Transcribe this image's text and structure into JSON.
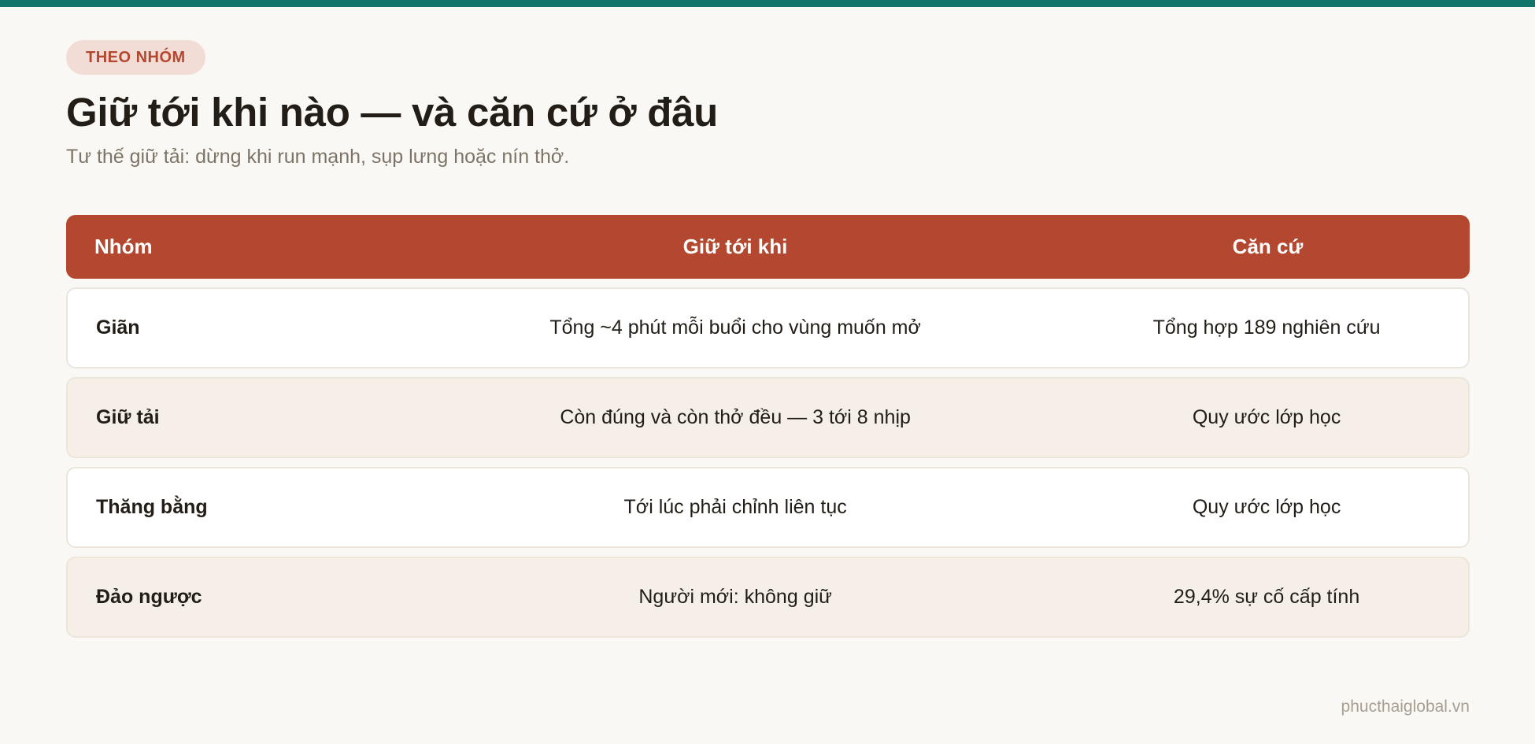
{
  "colors": {
    "top_bar": "#12756b",
    "accent": "#b3472f",
    "pill_bg": "#f2ddd6",
    "background": "#faf8f4",
    "row_odd": "#ffffff",
    "row_even": "#f5efe7"
  },
  "tag": "THEO NHÓM",
  "title": "Giữ tới khi nào — và căn cứ ở đâu",
  "subtitle": "Tư thế giữ tải: dừng khi run mạnh, sụp lưng hoặc nín thở.",
  "table": {
    "headers": [
      "Nhóm",
      "Giữ tới khi",
      "Căn cứ"
    ],
    "rows": [
      [
        "Giãn",
        "Tổng ~4 phút mỗi buổi cho vùng muốn mở",
        "Tổng hợp 189 nghiên cứu"
      ],
      [
        "Giữ tải",
        "Còn đúng và còn thở đều — 3 tới 8 nhịp",
        "Quy ước lớp học"
      ],
      [
        "Thăng bằng",
        "Tới lúc phải chỉnh liên tục",
        "Quy ước lớp học"
      ],
      [
        "Đảo ngược",
        "Người mới: không giữ",
        "29,4% sự cố cấp tính"
      ]
    ]
  },
  "footer": "phucthaiglobal.vn"
}
